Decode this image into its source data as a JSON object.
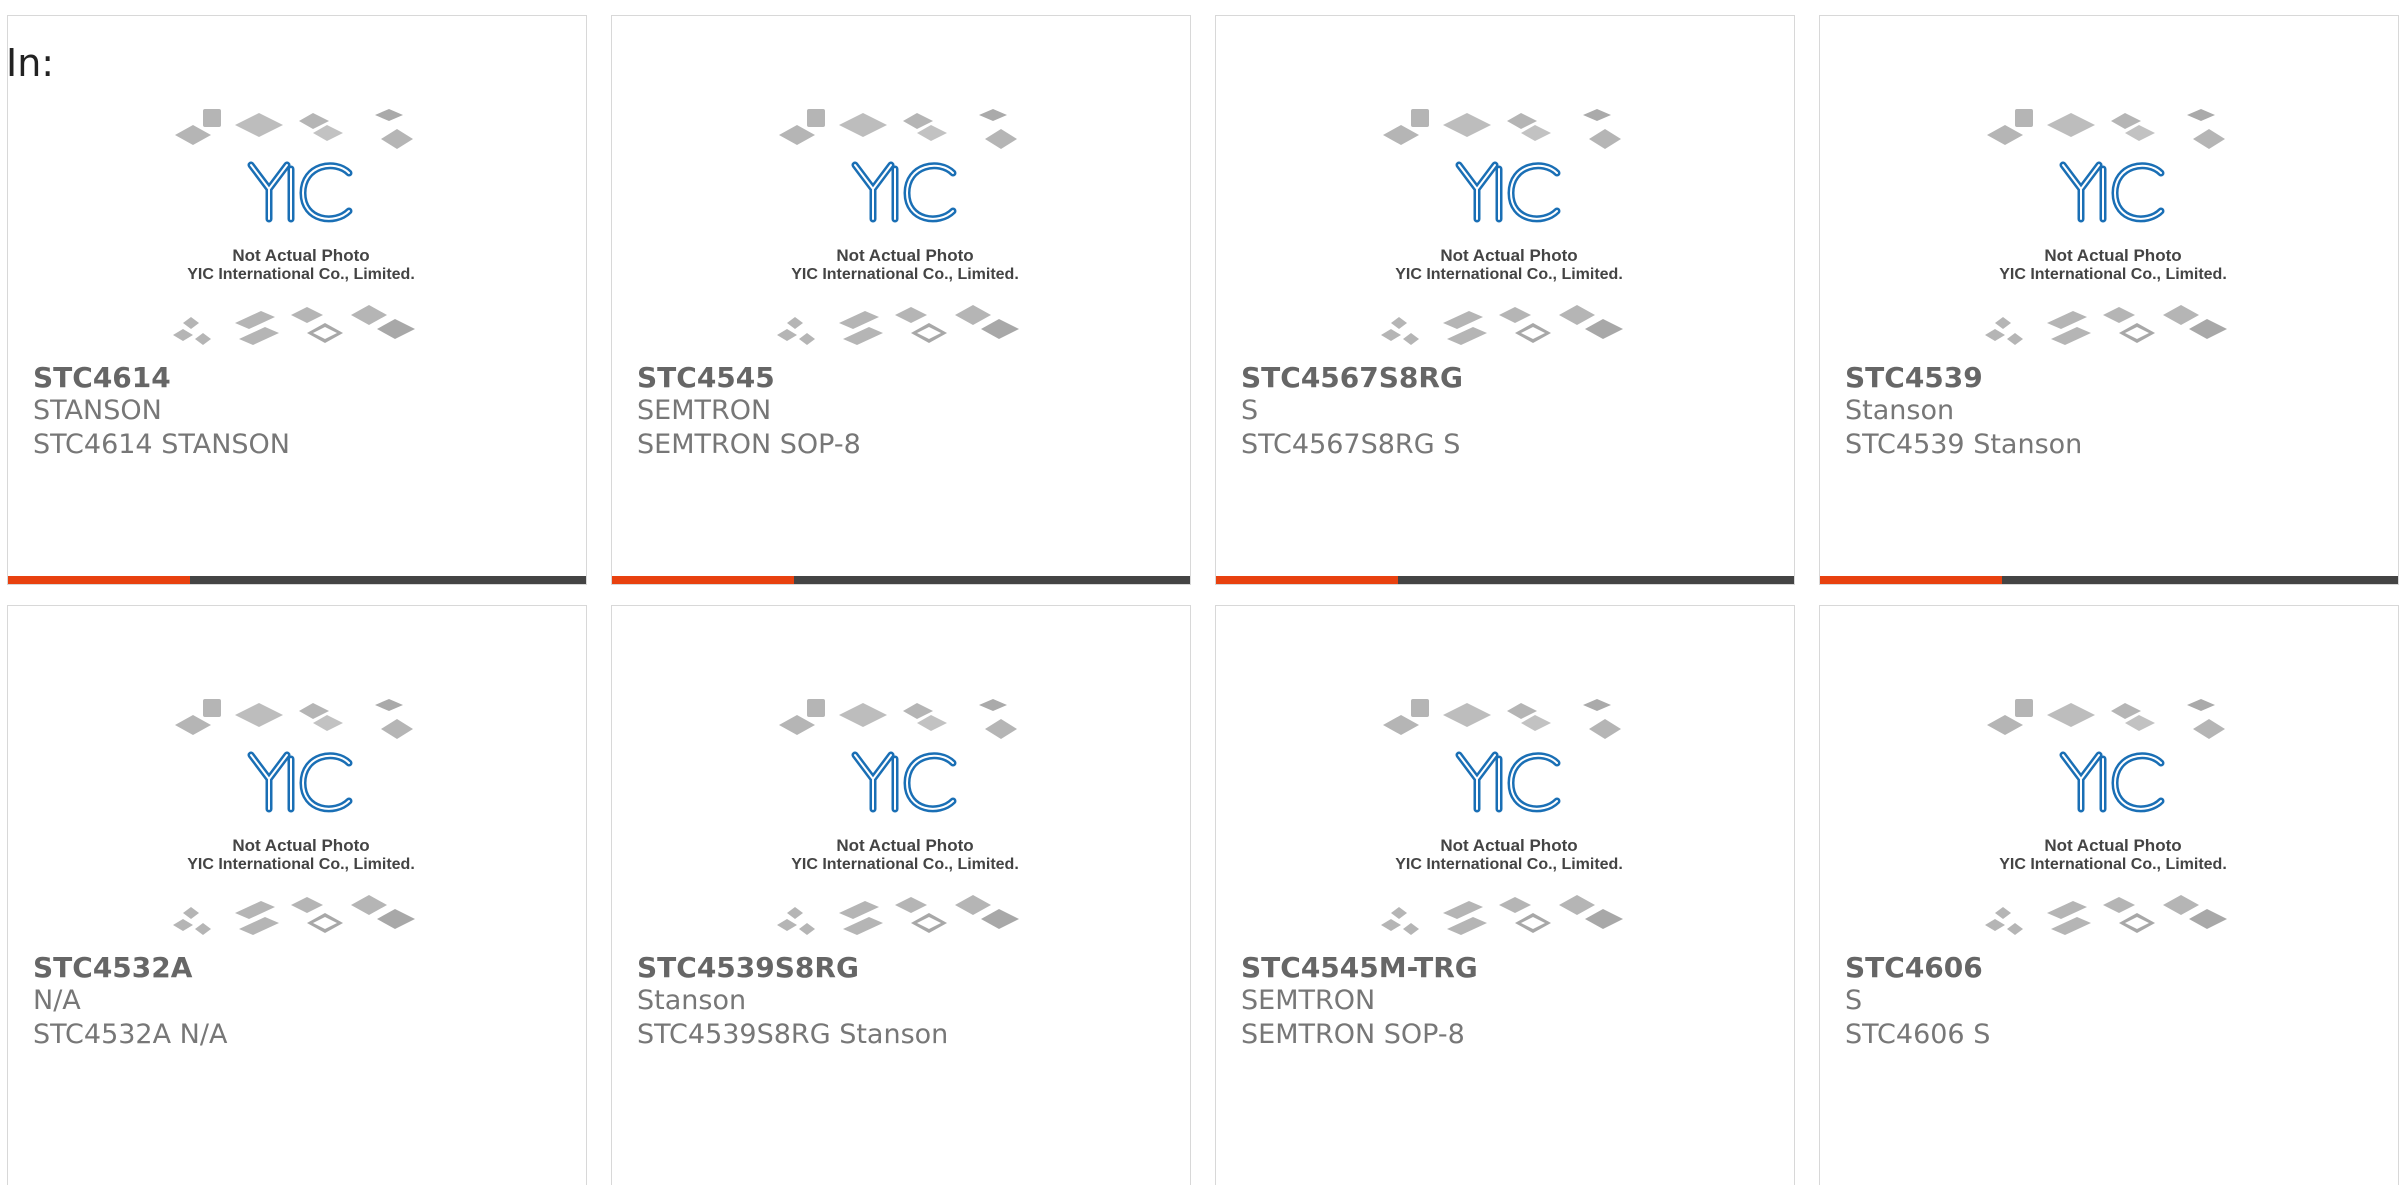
{
  "filter": {
    "label": "In:"
  },
  "colors": {
    "accent": "#e8410f",
    "bar": "#444444",
    "logo": "#1a6fb5",
    "chip": "#b0b0b0"
  },
  "placeholder": {
    "logo_text": "YIC",
    "line1": "Not Actual Photo",
    "line2": "YIC International Co., Limited."
  },
  "products": [
    {
      "part": "STC4614",
      "brand": "STANSON",
      "desc": "STC4614 STANSON"
    },
    {
      "part": "STC4545",
      "brand": "SEMTRON",
      "desc": "SEMTRON SOP-8"
    },
    {
      "part": "STC4567S8RG",
      "brand": "S",
      "desc": "STC4567S8RG S"
    },
    {
      "part": "STC4539",
      "brand": "Stanson",
      "desc": "STC4539 Stanson"
    },
    {
      "part": "STC4532A",
      "brand": "N/A",
      "desc": "STC4532A N/A"
    },
    {
      "part": "STC4539S8RG",
      "brand": "Stanson",
      "desc": "STC4539S8RG Stanson"
    },
    {
      "part": "STC4545M-TRG",
      "brand": "SEMTRON",
      "desc": "SEMTRON SOP-8"
    },
    {
      "part": "STC4606",
      "brand": "S",
      "desc": "STC4606 S"
    }
  ]
}
